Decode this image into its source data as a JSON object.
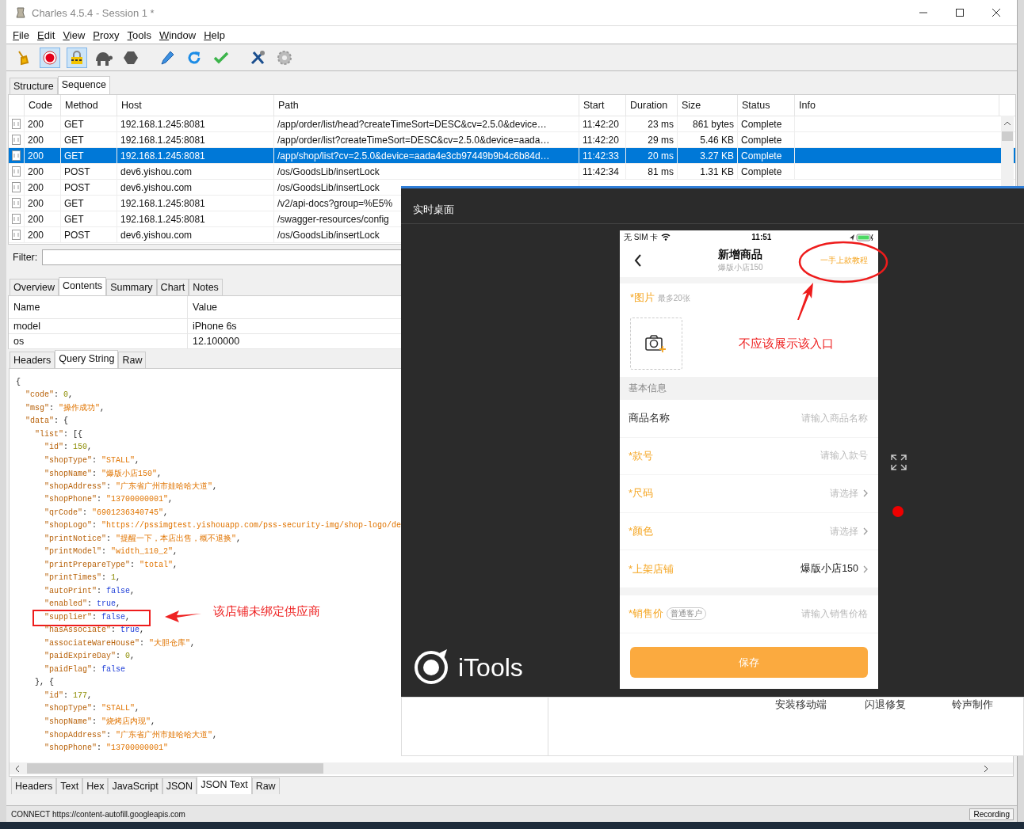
{
  "window": {
    "title": "Charles 4.5.4 - Session 1 *"
  },
  "menu": [
    "File",
    "Edit",
    "View",
    "Proxy",
    "Tools",
    "Window",
    "Help"
  ],
  "toolbar": [
    {
      "selected": false
    },
    {
      "selected": true
    },
    {
      "selected": true
    },
    {
      "selected": false
    },
    {
      "selected": false
    },
    {
      "selected": false
    },
    {
      "selected": false
    },
    {
      "selected": false
    },
    {
      "selected": false
    },
    {
      "selected": false
    }
  ],
  "view_tabs": [
    {
      "label": "Structure",
      "selected": false
    },
    {
      "label": "Sequence",
      "selected": true
    }
  ],
  "requests": {
    "columns": [
      "Code",
      "Method",
      "Host",
      "Path",
      "Start",
      "Duration",
      "Size",
      "Status",
      "Info"
    ],
    "rows": [
      {
        "selected": false,
        "cells": [
          "200",
          "GET",
          "192.168.1.245:8081",
          "/app/order/list/head?createTimeSort=DESC&cv=2.5.0&device…",
          "11:42:20",
          "23 ms",
          "861 bytes",
          "Complete"
        ]
      },
      {
        "selected": false,
        "cells": [
          "200",
          "GET",
          "192.168.1.245:8081",
          "/app/order/list?createTimeSort=DESC&cv=2.5.0&device=aada…",
          "11:42:20",
          "29 ms",
          "5.46 KB",
          "Complete"
        ]
      },
      {
        "selected": true,
        "cells": [
          "200",
          "GET",
          "192.168.1.245:8081",
          "/app/shop/list?cv=2.5.0&device=aada4e3cb97449b9b4c6b84d…",
          "11:42:33",
          "20 ms",
          "3.27 KB",
          "Complete"
        ]
      },
      {
        "selected": false,
        "cells": [
          "200",
          "POST",
          "dev6.yishou.com",
          "/os/GoodsLib/insertLock",
          "11:42:34",
          "81 ms",
          "1.31 KB",
          "Complete"
        ]
      },
      {
        "selected": false,
        "cells": [
          "200",
          "POST",
          "dev6.yishou.com",
          "/os/GoodsLib/insertLock"
        ]
      },
      {
        "selected": false,
        "cells": [
          "200",
          "GET",
          "192.168.1.245:8081",
          "/v2/api-docs?group=%E5%"
        ]
      },
      {
        "selected": false,
        "cells": [
          "200",
          "GET",
          "192.168.1.245:8081",
          "/swagger-resources/config"
        ]
      },
      {
        "selected": false,
        "cells": [
          "200",
          "POST",
          "dev6.yishou.com",
          "/os/GoodsLib/insertLock"
        ]
      }
    ]
  },
  "filter": {
    "label": "Filter:"
  },
  "detail_tabs": [
    {
      "label": "Overview",
      "selected": false
    },
    {
      "label": "Contents",
      "selected": true
    },
    {
      "label": "Summary",
      "selected": false
    },
    {
      "label": "Chart",
      "selected": false
    },
    {
      "label": "Notes",
      "selected": false
    }
  ],
  "params": {
    "columns": [
      "Name",
      "Value"
    ],
    "rows": [
      [
        "model",
        "iPhone 6s"
      ],
      [
        "os",
        "12.100000"
      ]
    ]
  },
  "request_tabs": [
    {
      "label": "Headers",
      "selected": false
    },
    {
      "label": "Query String",
      "selected": true
    },
    {
      "label": "Raw",
      "selected": false
    }
  ],
  "json_lines": [
    {
      "text": "{",
      "annotated": false
    },
    {
      "text": "  \"code\": 0,",
      "annotated": false
    },
    {
      "text": "  \"msg\": \"操作成功\",",
      "annotated": false
    },
    {
      "text": "  \"data\": {",
      "annotated": false
    },
    {
      "text": "    \"list\": [{",
      "annotated": false
    },
    {
      "text": "      \"id\": 150,",
      "annotated": false
    },
    {
      "text": "      \"shopType\": \"STALL\",",
      "annotated": false
    },
    {
      "text": "      \"shopName\": \"爆版小店150\",",
      "annotated": false
    },
    {
      "text": "      \"shopAddress\": \"广东省广州市娃哈哈大道\",",
      "annotated": false
    },
    {
      "text": "      \"shopPhone\": \"13700000001\",",
      "annotated": false
    },
    {
      "text": "      \"qrCode\": \"6901236340745\",",
      "annotated": false
    },
    {
      "text": "      \"shopLogo\": \"https://pssimgtest.yishouapp.com/pss-security-img/shop-logo/de",
      "annotated": false
    },
    {
      "text": "      \"printNotice\": \"提醒一下，本店出售，概不退换\",",
      "annotated": false
    },
    {
      "text": "      \"printModel\": \"width_110_2\",",
      "annotated": false
    },
    {
      "text": "      \"printPrepareType\": \"total\",",
      "annotated": false
    },
    {
      "text": "      \"printTimes\": 1,",
      "annotated": false
    },
    {
      "text": "      \"autoPrint\": false,",
      "annotated": false
    },
    {
      "text": "      \"enabled\": true,",
      "annotated": false
    },
    {
      "text": "      \"supplier\": false,",
      "annotated": true,
      "note": "该店铺未绑定供应商"
    },
    {
      "text": "      \"hasAssociate\": true,",
      "annotated": false
    },
    {
      "text": "      \"associateWareHouse\": \"大胆仓库\",",
      "annotated": false
    },
    {
      "text": "      \"paidExpireDay\": 0,",
      "annotated": false
    },
    {
      "text": "      \"paidFlag\": false",
      "annotated": false
    },
    {
      "text": "    }, {",
      "annotated": false
    },
    {
      "text": "      \"id\": 177,",
      "annotated": false
    },
    {
      "text": "      \"shopType\": \"STALL\",",
      "annotated": false
    },
    {
      "text": "      \"shopName\": \"烧烤店内现\",",
      "annotated": false
    },
    {
      "text": "      \"shopAddress\": \"广东省广州市娃哈哈大道\",",
      "annotated": false
    },
    {
      "text": "      \"shopPhone\": \"13700000001\"",
      "annotated": false
    }
  ],
  "response_tabs": [
    {
      "label": "Headers",
      "selected": false
    },
    {
      "label": "Text",
      "selected": false
    },
    {
      "label": "Hex",
      "selected": false
    },
    {
      "label": "JavaScript",
      "selected": false
    },
    {
      "label": "JSON",
      "selected": false
    },
    {
      "label": "JSON Text",
      "selected": true
    },
    {
      "label": "Raw",
      "selected": false
    }
  ],
  "status_bar": {
    "text": "CONNECT https://content-autofill.googleapis.com",
    "button": "Recording"
  },
  "itools": {
    "title": "实时桌面",
    "logo": "iTools",
    "bottom_links": [
      "安装移动端",
      "闪退修复",
      "铃声制作"
    ],
    "phone": {
      "carrier": "无 SIM 卡",
      "time": "11:51",
      "nav": {
        "title": "新增商品",
        "subtitle": "爆版小店150",
        "link": "一手上款教程",
        "link_circled": true,
        "note": "不应该展示该入口"
      },
      "photo": {
        "label": "*图片",
        "hint": "最多20张"
      },
      "section": "基本信息",
      "rows": [
        {
          "label": "商品名称",
          "required": false,
          "placeholder": "请输入商品名称",
          "chevron": false
        },
        {
          "label": "*款号",
          "required": true,
          "placeholder": "请输入款号",
          "chevron": false
        },
        {
          "label": "*尺码",
          "required": true,
          "placeholder": "请选择",
          "chevron": true
        },
        {
          "label": "*颜色",
          "required": true,
          "placeholder": "请选择",
          "chevron": true
        },
        {
          "label": "*上架店铺",
          "required": true,
          "value": "爆版小店150",
          "chevron": true
        }
      ],
      "price": {
        "label": "*销售价",
        "tag": "普通客户",
        "placeholder": "请输入销售价格"
      },
      "save": "保存"
    }
  }
}
